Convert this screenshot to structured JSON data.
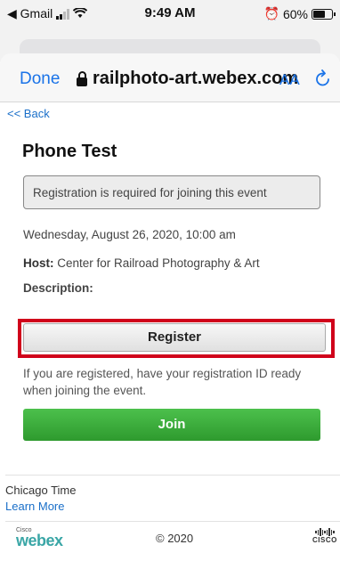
{
  "status_bar": {
    "back_app": "◀ Gmail",
    "time": "9:49 AM",
    "battery": "60%"
  },
  "browser": {
    "done_label": "Done",
    "url": "railphoto-art.webex.com",
    "text_size_label": "AA"
  },
  "page": {
    "back_link": "<< Back",
    "title": "Phone Test",
    "notice": "Registration is required for joining this event",
    "date": "Wednesday, August 26, 2020, 10:00 am",
    "host_label": "Host:",
    "host_value": "Center for Railroad Photography & Art",
    "description_label": "Description:",
    "register_label": "Register",
    "registered_hint": "If you are registered, have your registration ID ready when joining the event.",
    "join_label": "Join"
  },
  "footer": {
    "timezone": "Chicago Time",
    "learn_more": "Learn More",
    "copyright": "© 2020",
    "webex_logo_small": "Cisco",
    "webex_logo": "webex",
    "cisco_logo": "CISCO"
  },
  "colors": {
    "link": "#1a6fc9",
    "safari_blue": "#1a73e8",
    "join_green": "#2e9a2e",
    "highlight_red": "#d0021b"
  }
}
